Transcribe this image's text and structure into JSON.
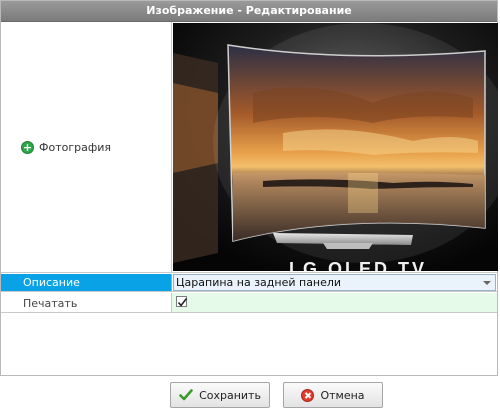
{
  "dialog": {
    "title": "Изображение - Редактирование"
  },
  "fields": {
    "photo_label": "Фотография",
    "description_label": "Описание",
    "description_value": "Царапина на задней панели",
    "print_label": "Печатать",
    "print_checked": true
  },
  "buttons": {
    "save_label": "Сохранить",
    "cancel_label": "Отмена"
  },
  "icons": {
    "photo_add": "plus-circle-icon",
    "save": "checkmark-icon",
    "cancel": "cancel-icon",
    "dropdown": "chevron-down-icon",
    "checkbox": "check-icon"
  },
  "colors": {
    "title_bar": "#8a8a8a",
    "selected_row": "#0aa2e6",
    "editable_cell": "#e6faea",
    "cancel_red": "#e03b2f",
    "add_green": "#2fa84a"
  },
  "photo_caption_fragment": "LG OLED TV"
}
